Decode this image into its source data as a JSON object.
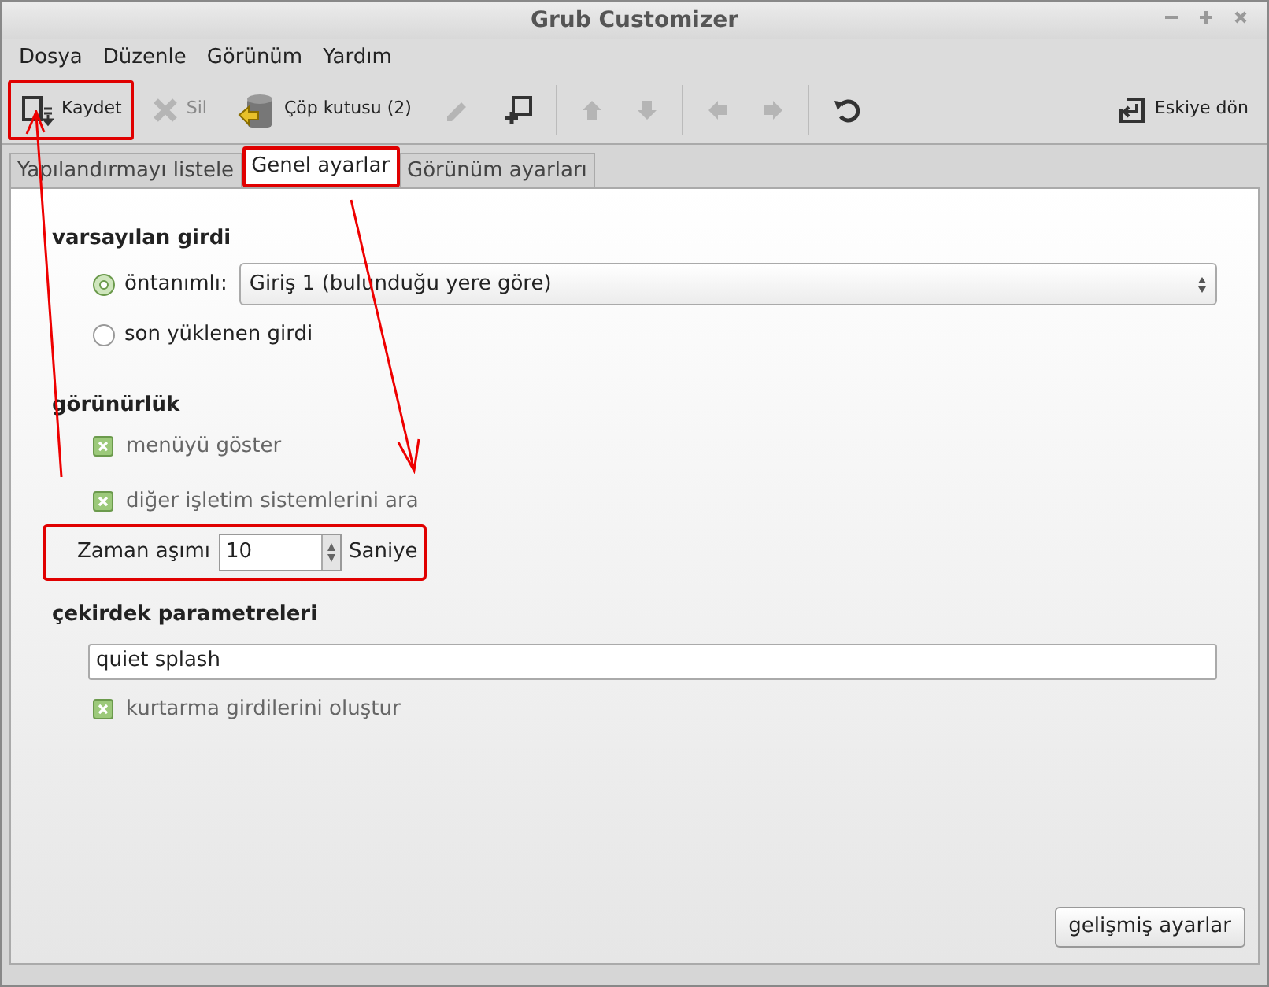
{
  "window": {
    "title": "Grub Customizer"
  },
  "menu": [
    "Dosya",
    "Düzenle",
    "Görünüm",
    "Yardım"
  ],
  "toolbar": [
    {
      "kind": "button",
      "label": "Kaydet",
      "disabled": false,
      "highlighted": true
    },
    {
      "kind": "button",
      "label": "Sil",
      "disabled": true,
      "highlighted": false
    },
    {
      "kind": "button",
      "label": "Çöp kutusu (2)",
      "disabled": false,
      "highlighted": false
    },
    {
      "kind": "button",
      "disabled": true,
      "highlighted": false
    },
    {
      "kind": "button",
      "disabled": false,
      "highlighted": false
    },
    {
      "kind": "separator"
    },
    {
      "kind": "button",
      "disabled": true,
      "highlighted": false
    },
    {
      "kind": "button",
      "disabled": true,
      "highlighted": false
    },
    {
      "kind": "separator"
    },
    {
      "kind": "button",
      "disabled": true,
      "highlighted": false
    },
    {
      "kind": "button",
      "disabled": true,
      "highlighted": false
    },
    {
      "kind": "separator"
    },
    {
      "kind": "button",
      "disabled": false,
      "highlighted": false
    },
    {
      "kind": "spacer"
    },
    {
      "kind": "button",
      "label": "Eskiye dön",
      "disabled": false,
      "highlighted": false
    }
  ],
  "tabs": [
    {
      "label": "Yapılandırmayı listele",
      "selected": false,
      "highlighted": false
    },
    {
      "label": "Genel ayarlar",
      "selected": true,
      "highlighted": true
    },
    {
      "label": "Görünüm ayarları",
      "selected": false,
      "highlighted": false
    }
  ],
  "default_entry": {
    "heading": "varsayılan girdi",
    "options": [
      {
        "label": "öntanımlı:",
        "selected": true
      },
      {
        "label": "son yüklenen girdi",
        "selected": false
      }
    ],
    "select": {
      "value": "Giriş 1 (bulunduğu yere göre)"
    }
  },
  "visibility": {
    "heading": "görünürlük",
    "checkboxes": [
      {
        "label": "menüyü göster",
        "checked": true
      },
      {
        "label": "diğer işletim sistemlerini ara",
        "checked": true
      }
    ],
    "timeout": {
      "label": "Zaman aşımı",
      "value": "10",
      "unit": "Saniye",
      "highlighted": true
    }
  },
  "kernel": {
    "heading": "çekirdek parametreleri",
    "value": "quiet splash",
    "checkbox": {
      "label": "kurtarma girdilerini oluştur",
      "checked": true
    }
  },
  "advanced_button": "gelişmiş ayarlar"
}
